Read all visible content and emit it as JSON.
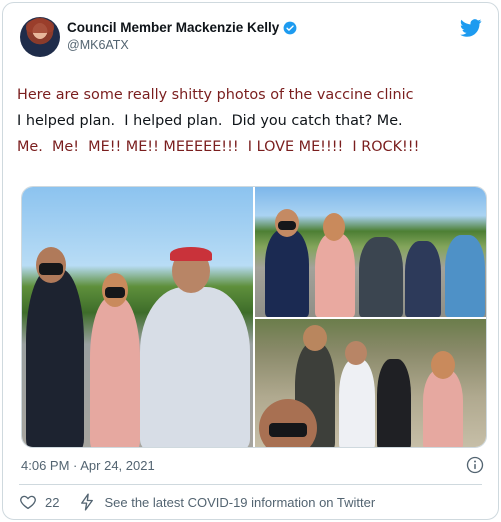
{
  "author": {
    "display_name": "Council Member Mackenzie Kelly",
    "handle": "@MK6ATX",
    "verified": true
  },
  "icons": {
    "platform": "twitter-bird-icon",
    "verified": "verified-badge-icon",
    "info": "info-icon",
    "like": "heart-icon",
    "covid_info": "lightning-bolt-icon"
  },
  "tweet": {
    "text_line_1": "Here are some really shitty photos of the vaccine clinic",
    "text_line_2": "I helped plan.  I helped plan.  Did you catch that? Me.",
    "text_line_3": "Me.  Me!  ME!! ME!! MEEEEE!!!  I LOVE ME!!!!  I ROCK!!!",
    "timestamp": "4:06 PM · Apr 24, 2021"
  },
  "engagement": {
    "like_count": "22",
    "covid_link": "See the latest COVID-19 information on Twitter"
  },
  "colors": {
    "twitter_blue": "#1d9bf0",
    "annotation_red": "#7a1e1e",
    "muted_text": "#536471",
    "border": "#cfd9de"
  }
}
